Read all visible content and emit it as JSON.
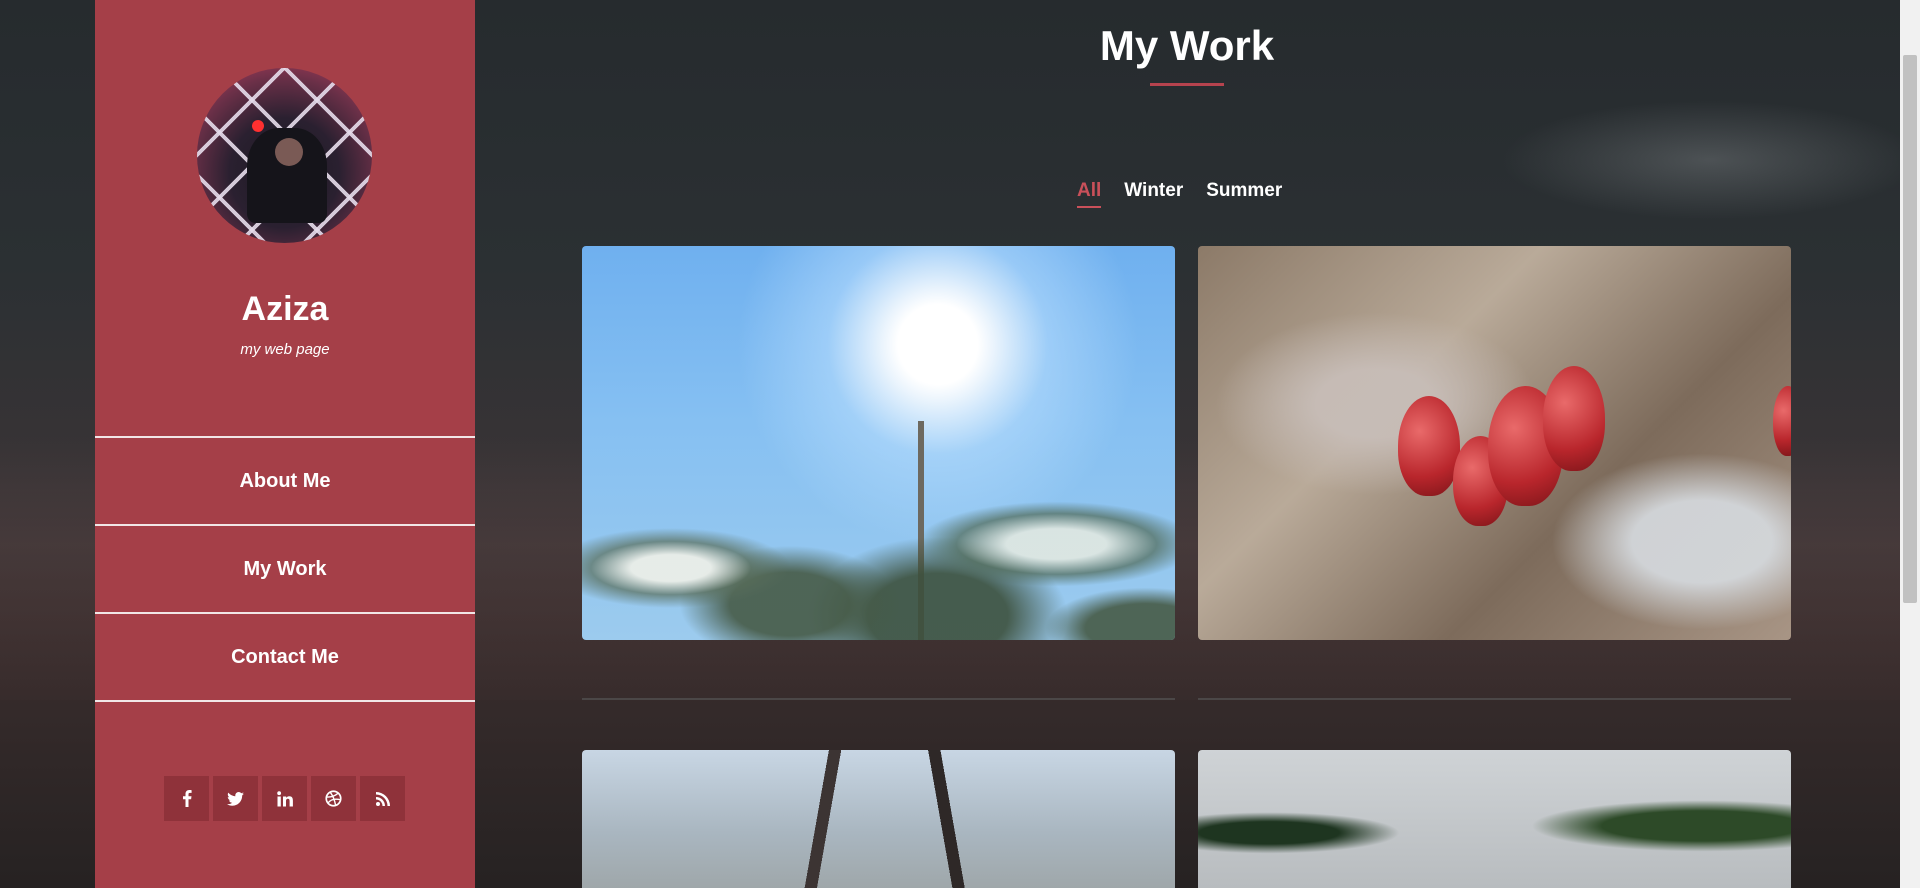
{
  "sidebar": {
    "name": "Aziza",
    "subtitle": "my web page",
    "nav": [
      "About Me",
      "My Work",
      "Contact Me"
    ],
    "social_icons": [
      "facebook-icon",
      "twitter-icon",
      "linkedin-icon",
      "dribbble-icon",
      "rss-icon"
    ]
  },
  "main": {
    "title": "My Work",
    "filters": [
      "All",
      "Winter",
      "Summer"
    ],
    "active_filter": "All"
  },
  "colors": {
    "accent": "#a53f48",
    "active_filter": "#c9505a"
  }
}
